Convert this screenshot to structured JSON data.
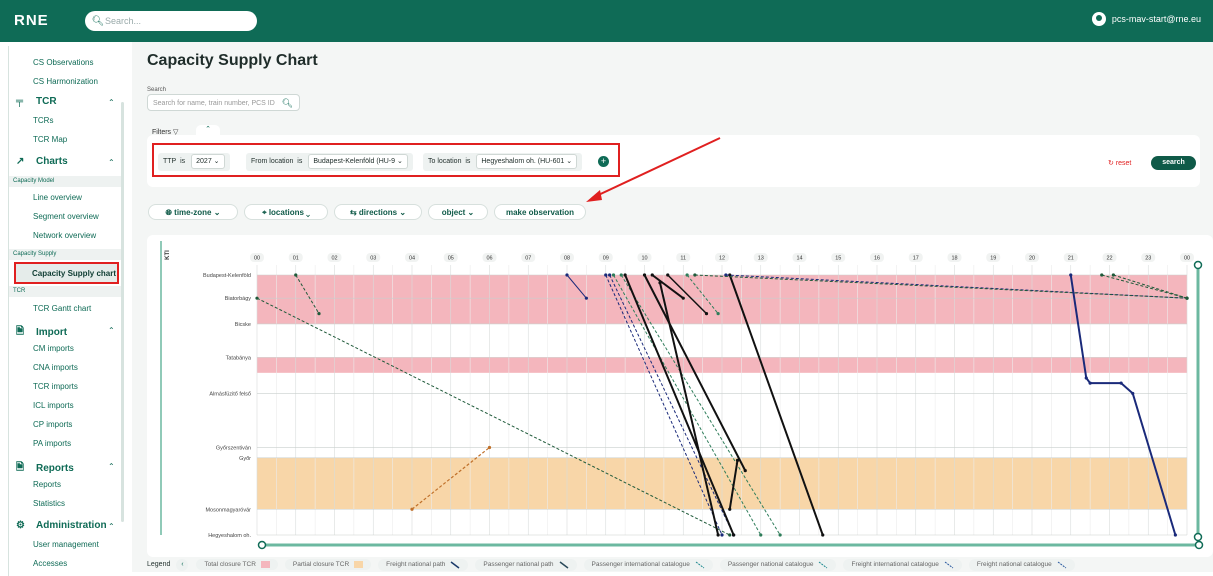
{
  "header": {
    "logo": "RNE",
    "search_placeholder": "Search...",
    "user": "pcs-mav-start@rne.eu"
  },
  "sidebar": {
    "items": [
      {
        "label": "CS Observations"
      },
      {
        "label": "CS Harmonization"
      },
      {
        "label": "TCR",
        "section": true
      },
      {
        "label": "TCRs"
      },
      {
        "label": "TCR Map"
      },
      {
        "label": "Charts",
        "section": true
      },
      {
        "label": "Capacity Model",
        "group": true
      },
      {
        "label": "Line overview"
      },
      {
        "label": "Segment overview"
      },
      {
        "label": "Network overview"
      },
      {
        "label": "Capacity Supply",
        "group": true
      },
      {
        "label": "Capacity Supply chart",
        "active": true
      },
      {
        "label": "TCR",
        "group": true
      },
      {
        "label": "TCR Gantt chart"
      },
      {
        "label": "Import",
        "section": true
      },
      {
        "label": "CM imports"
      },
      {
        "label": "CNA imports"
      },
      {
        "label": "TCR imports"
      },
      {
        "label": "ICL imports"
      },
      {
        "label": "CP imports"
      },
      {
        "label": "PA imports"
      },
      {
        "label": "Reports",
        "section": true
      },
      {
        "label": "Reports"
      },
      {
        "label": "Statistics"
      },
      {
        "label": "Administration",
        "section": true
      },
      {
        "label": "User management"
      },
      {
        "label": "Accesses"
      }
    ]
  },
  "page": {
    "title": "Capacity Supply Chart",
    "search_label": "Search",
    "search_placeholder": "Search for name, train number, PCS ID",
    "filters_label": "Filters",
    "filters": [
      {
        "field": "TTP",
        "op": "is",
        "value": "2027"
      },
      {
        "field": "From location",
        "op": "is",
        "value": "Budapest-Kelenföld (HU-9"
      },
      {
        "field": "To location",
        "op": "is",
        "value": "Hegyeshalom oh. (HU-601"
      }
    ],
    "reset_label": "reset",
    "search_button": "search"
  },
  "toolbar": {
    "time_zone": "time-zone",
    "locations": "locations",
    "directions": "directions",
    "object": "object",
    "make_observation": "make observation"
  },
  "chart_data": {
    "type": "line",
    "y_axis_label": "KTI",
    "x_ticks": [
      "00",
      "01",
      "02",
      "03",
      "04",
      "05",
      "06",
      "07",
      "08",
      "09",
      "10",
      "11",
      "12",
      "13",
      "14",
      "15",
      "16",
      "17",
      "18",
      "19",
      "20",
      "21",
      "22",
      "23",
      "00"
    ],
    "stations": [
      "Budapest-Kelenföld",
      "Biatorbágy",
      "Bicske",
      "Tatabánya",
      "Almásfüzitő felső",
      "Győrszentiván",
      "Győr",
      "Mosonmagyaróvár",
      "Hegyeshalom oh."
    ],
    "station_km": [
      0,
      9,
      19,
      32,
      46,
      67,
      71,
      91,
      101
    ],
    "closures": [
      {
        "type": "Total closure TCR",
        "from_km": 0,
        "to_km": 19
      },
      {
        "type": "Total closure TCR",
        "from_km": 32,
        "to_km": 38
      },
      {
        "type": "Partial closure TCR",
        "from_km": 71,
        "to_km": 91
      }
    ],
    "series": [
      {
        "color": "#1f5a3a",
        "dash": "3,2",
        "w": 1,
        "points": [
          [
            1.0,
            0
          ],
          [
            1.6,
            15
          ]
        ]
      },
      {
        "color": "#1f5a3a",
        "dash": "3,2",
        "w": 1,
        "points": [
          [
            0,
            9
          ],
          [
            12.2,
            101
          ]
        ]
      },
      {
        "color": "#c0702a",
        "dash": "3,2",
        "w": 1.2,
        "points": [
          [
            4.0,
            91
          ],
          [
            6.0,
            67
          ]
        ]
      },
      {
        "color": "#1a2a7a",
        "dash": "",
        "w": 1,
        "points": [
          [
            8.0,
            0
          ],
          [
            8.5,
            9
          ]
        ]
      },
      {
        "color": "#1a2a7a",
        "dash": "3,2",
        "w": 1,
        "points": [
          [
            9.0,
            0
          ],
          [
            12.0,
            101
          ]
        ]
      },
      {
        "color": "#1a2a7a",
        "dash": "3,2",
        "w": 1,
        "points": [
          [
            9.1,
            0
          ],
          [
            12.3,
            101
          ]
        ]
      },
      {
        "color": "#2e7d5a",
        "dash": "3,2",
        "w": 1,
        "points": [
          [
            9.2,
            0
          ],
          [
            13.0,
            101
          ]
        ]
      },
      {
        "color": "#2e7d5a",
        "dash": "3,2",
        "w": 1,
        "points": [
          [
            9.4,
            0
          ],
          [
            13.5,
            101
          ]
        ]
      },
      {
        "color": "#111111",
        "dash": "",
        "w": 2,
        "points": [
          [
            9.5,
            0
          ],
          [
            12.3,
            101
          ]
        ]
      },
      {
        "color": "#111111",
        "dash": "",
        "w": 2,
        "points": [
          [
            10.0,
            0
          ],
          [
            12.6,
            76
          ]
        ]
      },
      {
        "color": "#111111",
        "dash": "",
        "w": 2,
        "points": [
          [
            10.4,
            3
          ],
          [
            11.9,
            101
          ]
        ]
      },
      {
        "color": "#111111",
        "dash": "",
        "w": 2,
        "points": [
          [
            12.4,
            72
          ],
          [
            12.2,
            91
          ]
        ]
      },
      {
        "color": "#111111",
        "dash": "",
        "w": 2,
        "points": [
          [
            12.2,
            0
          ],
          [
            14.6,
            101
          ]
        ]
      },
      {
        "color": "#111111",
        "dash": "",
        "w": 2,
        "points": [
          [
            10.2,
            0
          ],
          [
            11.0,
            9
          ]
        ]
      },
      {
        "color": "#111111",
        "dash": "",
        "w": 1.5,
        "points": [
          [
            10.6,
            0
          ],
          [
            11.6,
            15
          ]
        ]
      },
      {
        "color": "#2e7d5a",
        "dash": "3,2",
        "w": 1,
        "points": [
          [
            11.1,
            0
          ],
          [
            11.9,
            15
          ]
        ]
      },
      {
        "color": "#1a2a7a",
        "dash": "3,2",
        "w": 1,
        "points": [
          [
            12.1,
            0
          ],
          [
            24,
            9
          ]
        ]
      },
      {
        "color": "#1f5a3a",
        "dash": "3,2",
        "w": 1,
        "points": [
          [
            11.3,
            0
          ],
          [
            24,
            9
          ]
        ]
      },
      {
        "color": "#1f5a3a",
        "dash": "3,2",
        "w": 1,
        "points": [
          [
            21.8,
            0
          ],
          [
            24,
            9
          ]
        ]
      },
      {
        "color": "#1f5a3a",
        "dash": "3,2",
        "w": 1,
        "points": [
          [
            22.1,
            0
          ],
          [
            24,
            9
          ]
        ]
      },
      {
        "color": "#1a2a7a",
        "dash": "",
        "w": 2,
        "points": [
          [
            21.0,
            0
          ],
          [
            21.4,
            40
          ],
          [
            21.5,
            42
          ],
          [
            22.3,
            42
          ],
          [
            22.6,
            46
          ],
          [
            23.7,
            101
          ]
        ]
      }
    ]
  },
  "legend": {
    "title": "Legend",
    "items": [
      {
        "label": "Total closure TCR",
        "color": "#f4b6bd"
      },
      {
        "label": "Partial closure TCR",
        "color": "#f8d6a8"
      },
      {
        "label": "Freight national path",
        "color": "#1a3a6a"
      },
      {
        "label": "Passenger national path",
        "color": "#2a4a5a"
      },
      {
        "label": "Passenger international catalogue",
        "color": "#1e8a90"
      },
      {
        "label": "Passenger national catalogue",
        "color": "#1e8a90"
      },
      {
        "label": "Freight international catalogue",
        "color": "#2a5aa0"
      },
      {
        "label": "Freight national catalogue",
        "color": "#2a5aa0"
      }
    ]
  }
}
